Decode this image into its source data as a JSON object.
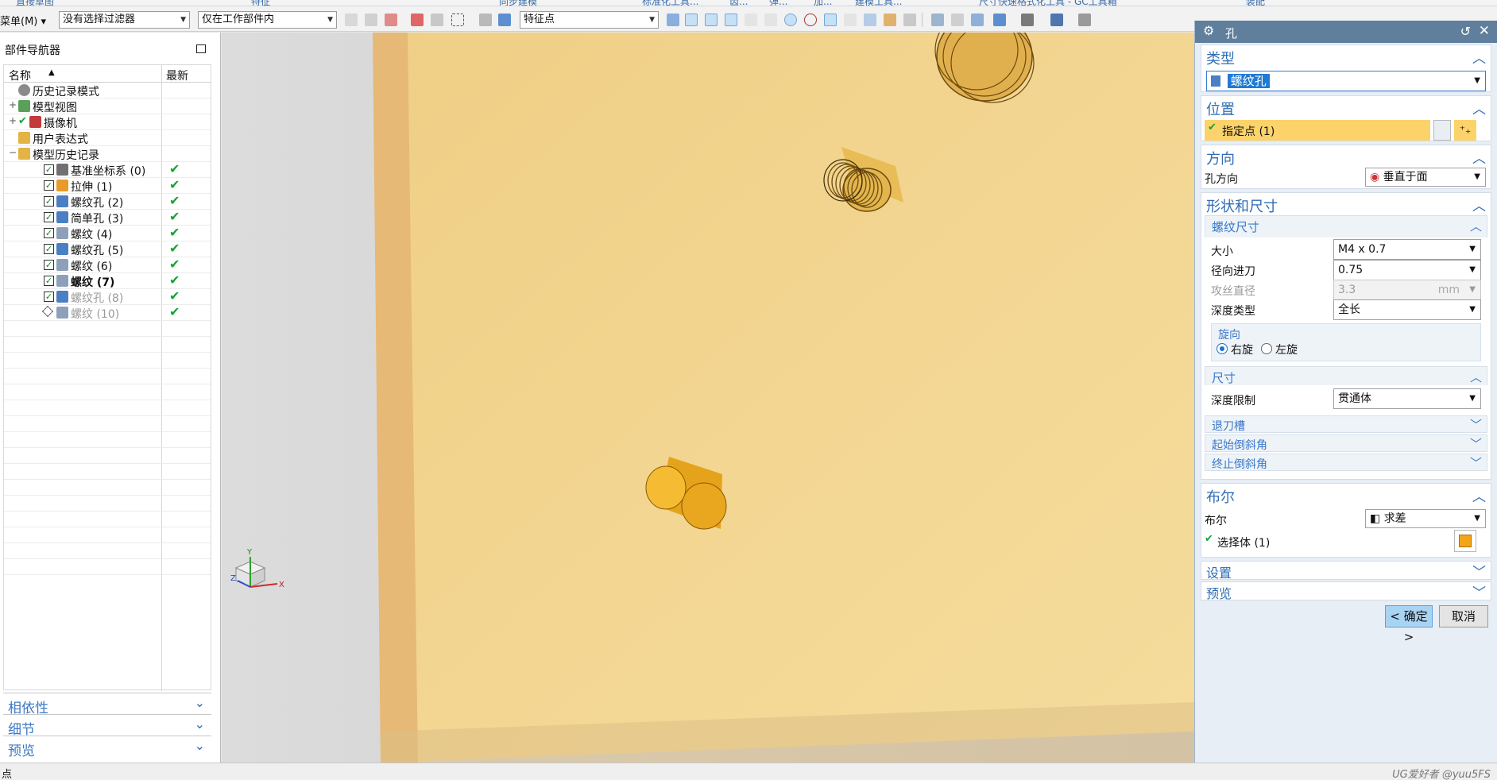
{
  "top_strip": [
    "直接草图",
    "特征",
    "同步建模",
    "标准化工具...",
    "齿...",
    "弹...",
    "加...",
    "建模工具...",
    "尺寸快速格式化工具 - GC工具箱",
    "装配"
  ],
  "toolbar": {
    "menu_label": "菜单(M)",
    "filter_value": "没有选择过滤器",
    "scope_value": "仅在工作部件内",
    "snap_value": "特征点"
  },
  "navigator": {
    "title": "部件导航器",
    "col_name": "名称",
    "col_latest": "最新",
    "items": [
      {
        "toggle": "",
        "label": "历史记录模式",
        "icon": "clock-icon",
        "checked": false,
        "latest": false,
        "style": "normal"
      },
      {
        "toggle": "+",
        "label": "模型视图",
        "icon": "model-views-icon",
        "checked": false,
        "latest": false,
        "style": "normal"
      },
      {
        "toggle": "+",
        "label": "摄像机",
        "icon": "camera-icon",
        "checked": true,
        "latest": false,
        "style": "normal"
      },
      {
        "toggle": "",
        "label": "用户表达式",
        "icon": "folder-icon",
        "checked": false,
        "latest": false,
        "style": "normal"
      },
      {
        "toggle": "−",
        "label": "模型历史记录",
        "icon": "folder-icon",
        "checked": false,
        "latest": false,
        "style": "normal"
      },
      {
        "toggle": "",
        "label": "基准坐标系 (0)",
        "icon": "datum-csys-icon",
        "checked": true,
        "latest": true,
        "style": "normal"
      },
      {
        "toggle": "",
        "label": "拉伸 (1)",
        "icon": "extrude-icon",
        "checked": true,
        "latest": true,
        "style": "normal"
      },
      {
        "toggle": "",
        "label": "螺纹孔 (2)",
        "icon": "threaded-hole-icon",
        "checked": true,
        "latest": true,
        "style": "normal"
      },
      {
        "toggle": "",
        "label": "简单孔 (3)",
        "icon": "simple-hole-icon",
        "checked": true,
        "latest": true,
        "style": "normal"
      },
      {
        "toggle": "",
        "label": "螺纹 (4)",
        "icon": "thread-icon",
        "checked": true,
        "latest": true,
        "style": "normal"
      },
      {
        "toggle": "",
        "label": "螺纹孔 (5)",
        "icon": "threaded-hole-icon",
        "checked": true,
        "latest": true,
        "style": "normal"
      },
      {
        "toggle": "",
        "label": "螺纹 (6)",
        "icon": "thread-icon",
        "checked": true,
        "latest": true,
        "style": "normal"
      },
      {
        "toggle": "",
        "label": "螺纹 (7)",
        "icon": "thread-icon",
        "checked": true,
        "latest": true,
        "style": "bold"
      },
      {
        "toggle": "",
        "label": "螺纹孔 (8)",
        "icon": "threaded-hole-icon",
        "checked": true,
        "latest": true,
        "style": "grey"
      },
      {
        "toggle": "",
        "label": "螺纹 (10)",
        "icon": "thread-icon",
        "checked": false,
        "latest": true,
        "style": "grey"
      }
    ],
    "sections": [
      "相依性",
      "细节",
      "预览"
    ]
  },
  "viewport": {
    "axis_x": "X",
    "axis_y": "Y",
    "axis_z": "Z"
  },
  "dialog": {
    "title": "孔",
    "type_header": "类型",
    "type_value": "螺纹孔",
    "position_header": "位置",
    "specify_point": "指定点 (1)",
    "direction_header": "方向",
    "hole_direction_label": "孔方向",
    "hole_direction_value": "垂直于面",
    "shape_header": "形状和尺寸",
    "thread_size_header": "螺纹尺寸",
    "size_label": "大小",
    "size_value": "M4 x 0.7",
    "radial_label": "径向进刀",
    "radial_value": "0.75",
    "tap_label": "攻丝直径",
    "tap_value": "3.3",
    "tap_unit": "mm",
    "depth_type_label": "深度类型",
    "depth_type_value": "全长",
    "hand_header": "旋向",
    "right_hand": "右旋",
    "left_hand": "左旋",
    "dims_header": "尺寸",
    "depth_limit_label": "深度限制",
    "depth_limit_value": "贯通体",
    "relief_header": "退刀槽",
    "start_chamfer_header": "起始倒斜角",
    "end_chamfer_header": "终止倒斜角",
    "boolean_header": "布尔",
    "boolean_label": "布尔",
    "boolean_value": "求差",
    "select_body": "选择体 (1)",
    "settings_header": "设置",
    "preview_header": "预览",
    "ok_label": "< 确定 >",
    "cancel_label": "取消"
  },
  "status": {
    "text": "点",
    "watermark": "UG爱好者 @yuu5FS"
  },
  "colors": {
    "part_face": "#f1d58e",
    "accent": "#2e6cb4",
    "highlight_row": "#fbd36a",
    "check_green": "#12a532"
  }
}
